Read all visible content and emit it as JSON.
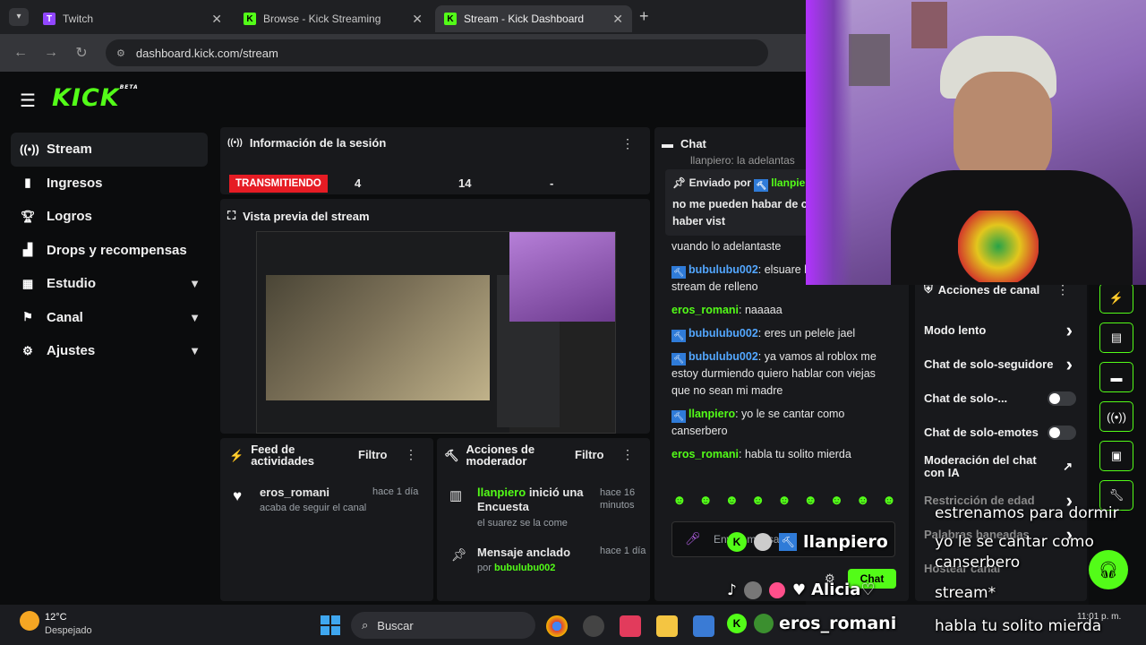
{
  "browser": {
    "tabs": [
      {
        "label": "Twitch",
        "color": "#9146ff",
        "fav": "T"
      },
      {
        "label": "Browse - Kick Streaming",
        "color": "#53fc18",
        "fav": "K"
      },
      {
        "label": "Stream - Kick Dashboard",
        "color": "#53fc18",
        "fav": "K"
      }
    ],
    "url": "dashboard.kick.com/stream"
  },
  "app": {
    "logo": "KICK",
    "logo_sup": "BETA",
    "sidebar": [
      {
        "label": "Stream",
        "icon": "broadcast-icon"
      },
      {
        "label": "Ingresos",
        "icon": "bar-chart-icon"
      },
      {
        "label": "Logros",
        "icon": "trophy-icon"
      },
      {
        "label": "Drops y recompensas",
        "icon": "drops-icon"
      },
      {
        "label": "Estudio",
        "icon": "grid-icon"
      },
      {
        "label": "Canal",
        "icon": "channel-icon"
      },
      {
        "label": "Ajustes",
        "icon": "gear-icon"
      }
    ],
    "session": {
      "title": "Información de la sesión",
      "status": "TRANSMITIENDO",
      "stat1": "4",
      "stat2": "14",
      "stat3": "-"
    },
    "preview": {
      "title": "Vista previa del stream"
    },
    "feed": {
      "title": "Feed de actividades",
      "filter": "Filtro",
      "item_user": "eros_romani",
      "item_text": "acaba de seguir el canal",
      "item_time": "hace 1 día"
    },
    "mod_actions": {
      "title": "Acciones de moderador",
      "filter": "Filtro",
      "poll_user": "llanpiero",
      "poll_text": "inició una Encuesta",
      "poll_time": "hace 16 minutos",
      "poll_sub": "el suarez se la come",
      "pin_title": "Mensaje anclado",
      "pin_time": "hace 1 día",
      "pin_by": "por",
      "pin_user": "bubulubu002"
    },
    "chat": {
      "title": "Chat",
      "pinned_label": "Enviado por",
      "pinned_user": "llanpiero",
      "pinned_text": "no me pueden habar de cantantes sin haber vist",
      "top_partial": "llanpiero: la adelantas",
      "messages": [
        {
          "user": "",
          "text": "vuando lo adelantaste",
          "color": "",
          "mod": false
        },
        {
          "user": "bubulubu002",
          "text": "elsuare live come join stream de relleno",
          "color": "#53a7ff",
          "mod": true
        },
        {
          "user": "eros_romani",
          "text": "naaaaa",
          "color": "#53fc18",
          "mod": false
        },
        {
          "user": "bubulubu002",
          "text": "eres un pelele jael",
          "color": "#53a7ff",
          "mod": true
        },
        {
          "user": "bubulubu002",
          "text": "ya vamos al roblox me estoy durmiendo quiero hablar con viejas que no sean mi madre",
          "color": "#53a7ff",
          "mod": true
        },
        {
          "user": "llanpiero",
          "text": "yo le se cantar como canserbero",
          "color": "#53fc18",
          "mod": true
        },
        {
          "user": "eros_romani",
          "text": "habla tu solito mierda",
          "color": "#53fc18",
          "mod": false
        }
      ],
      "input_placeholder": "Enviar mensaje",
      "send": "Chat"
    },
    "channel_actions": {
      "title": "Acciones de canal",
      "rows": [
        {
          "label": "Modo lento",
          "ctrl": "chevron"
        },
        {
          "label": "Chat de solo-seguidore",
          "ctrl": "chevron"
        },
        {
          "label": "Chat de solo-...",
          "ctrl": "toggle"
        },
        {
          "label": "Chat de solo-emotes",
          "ctrl": "toggle"
        },
        {
          "label": "Moderación del chat con IA",
          "ctrl": "link"
        },
        {
          "label": "Restricción de edad",
          "ctrl": "chevron"
        },
        {
          "label": "Palabras baneadas",
          "ctrl": "chevron"
        },
        {
          "label": "Hostear canal",
          "ctrl": "none"
        }
      ]
    }
  },
  "overlay": {
    "captions": [
      "estrenamos para dormir",
      "yo le se cantar como canserbero",
      "stream*",
      "habla tu solito mierda"
    ],
    "names": [
      "llanpiero",
      "Alicia♡",
      "eros_romani"
    ]
  },
  "taskbar": {
    "temp": "12°C",
    "weather": "Despejado",
    "search": "Buscar",
    "time": "11:01 p. m."
  }
}
